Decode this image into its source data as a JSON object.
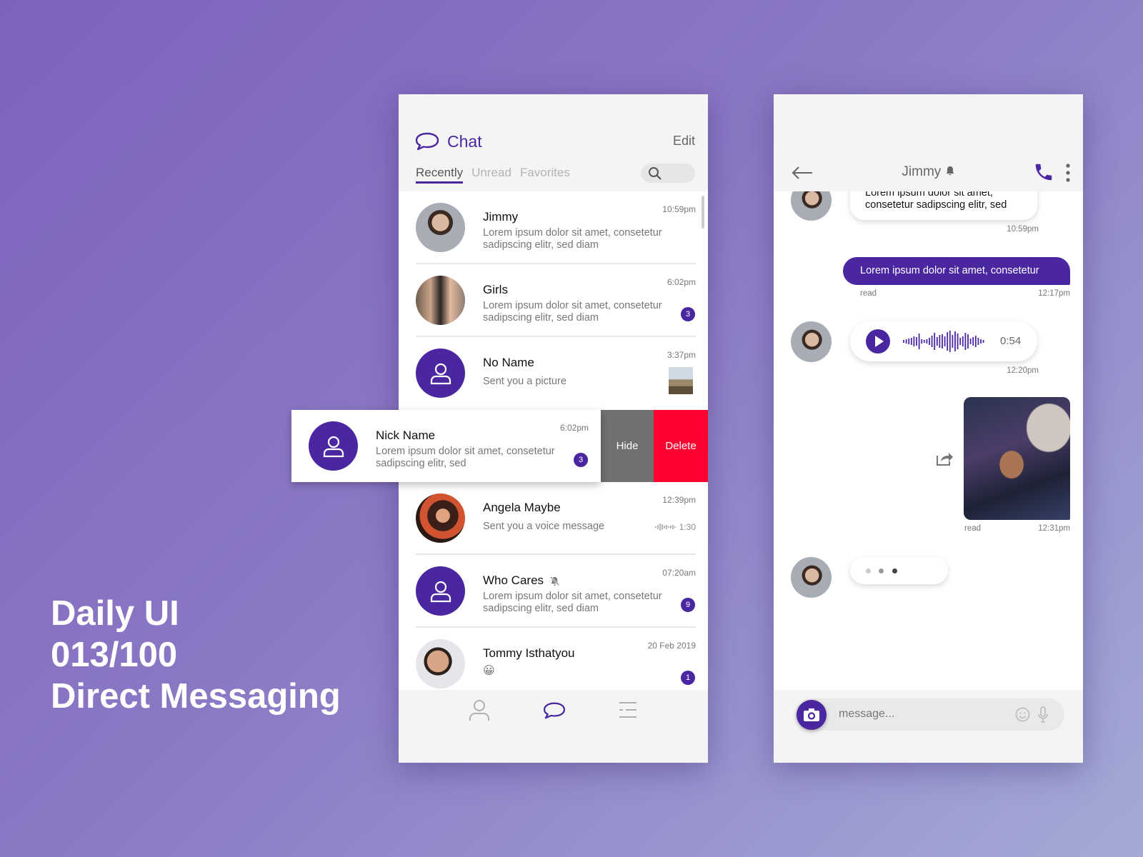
{
  "caption": {
    "line1": "Daily UI",
    "line2": "013/100",
    "line3": "Direct Messaging"
  },
  "colors": {
    "accent": "#4a27a0",
    "delete": "#ff0030",
    "hide": "#707070"
  },
  "list": {
    "title": "Chat",
    "edit_label": "Edit",
    "tabs": [
      {
        "label": "Recently",
        "active": true
      },
      {
        "label": "Unread"
      },
      {
        "label": "Favorites"
      }
    ],
    "search_icon": "search-icon",
    "rows": [
      {
        "name": "Jimmy",
        "time": "10:59pm",
        "preview": "Lorem ipsum dolor sit amet, consetetur sadipscing elitr, sed diam"
      },
      {
        "name": "Girls",
        "time": "6:02pm",
        "preview": "Lorem ipsum dolor sit amet, consetetur sadipscing elitr, sed diam",
        "badge": "3"
      },
      {
        "name": "No Name",
        "time": "3:37pm",
        "preview": "Sent you a picture"
      },
      {
        "name": "Nick Name",
        "time": "6:02pm",
        "preview": "Lorem ipsum dolor sit amet, consetetur sadipscing elitr, sed",
        "badge": "3"
      },
      {
        "name": "Angela Maybe",
        "time": "12:39pm",
        "preview": "Sent you a voice message",
        "voice_duration": "1:30"
      },
      {
        "name": "Who Cares",
        "time": "07:20am",
        "preview": "Lorem ipsum dolor sit amet, consetetur sadipscing elitr, sed diam",
        "badge": "9",
        "muted": true
      },
      {
        "name": "Tommy Isthatyou",
        "time": "20 Feb 2019",
        "preview": "😀",
        "badge": "1"
      }
    ],
    "swipe_actions": {
      "hide": "Hide",
      "delete": "Delete"
    },
    "nav": [
      "profile-icon",
      "chat-icon",
      "menu-icon"
    ]
  },
  "conversation": {
    "contact": "Jimmy",
    "messages": [
      {
        "from": "them",
        "text_line1": "Lorem ipsum dolor sit amet,",
        "text_line2": "consetetur sadipscing elitr, sed",
        "time": "10:59pm"
      },
      {
        "from": "me",
        "text": "Lorem ipsum dolor sit amet, consetetur",
        "status": "read",
        "time": "12:17pm"
      },
      {
        "from": "them",
        "type": "voice",
        "duration": "0:54",
        "time": "12:20pm"
      },
      {
        "from": "me",
        "type": "image",
        "status": "read",
        "time": "12:31pm"
      },
      {
        "from": "them",
        "type": "typing"
      }
    ],
    "input_placeholder": "message..."
  }
}
